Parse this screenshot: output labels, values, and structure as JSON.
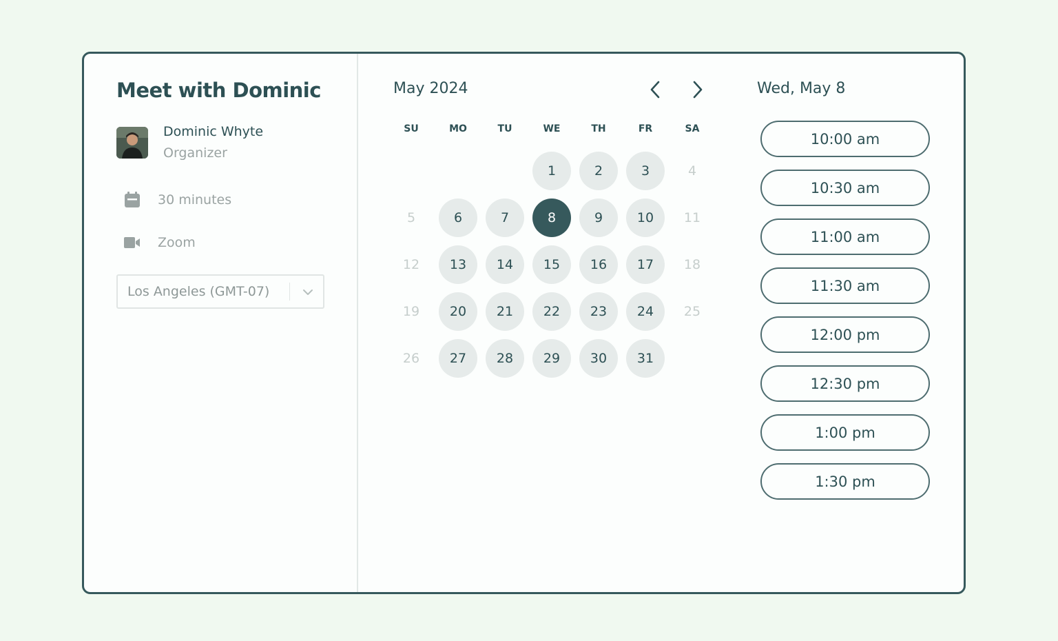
{
  "title": "Meet with Dominic",
  "organizer": {
    "name": "Dominic Whyte",
    "role": "Organizer"
  },
  "details": {
    "duration": "30 minutes",
    "duration_icon": "calendar-icon",
    "location": "Zoom",
    "location_icon": "video-camera-icon"
  },
  "timezone": {
    "value": "Los Angeles (GMT-07)"
  },
  "calendar": {
    "month_label": "May 2024",
    "weekdays": [
      "SU",
      "MO",
      "TU",
      "WE",
      "TH",
      "FR",
      "SA"
    ],
    "weeks": [
      [
        null,
        null,
        null,
        {
          "d": "1",
          "s": "available"
        },
        {
          "d": "2",
          "s": "available"
        },
        {
          "d": "3",
          "s": "available"
        },
        {
          "d": "4",
          "s": "disabled"
        }
      ],
      [
        {
          "d": "5",
          "s": "disabled"
        },
        {
          "d": "6",
          "s": "available"
        },
        {
          "d": "7",
          "s": "available"
        },
        {
          "d": "8",
          "s": "selected"
        },
        {
          "d": "9",
          "s": "available"
        },
        {
          "d": "10",
          "s": "available"
        },
        {
          "d": "11",
          "s": "disabled"
        }
      ],
      [
        {
          "d": "12",
          "s": "disabled"
        },
        {
          "d": "13",
          "s": "available"
        },
        {
          "d": "14",
          "s": "available"
        },
        {
          "d": "15",
          "s": "available"
        },
        {
          "d": "16",
          "s": "available"
        },
        {
          "d": "17",
          "s": "available"
        },
        {
          "d": "18",
          "s": "disabled"
        }
      ],
      [
        {
          "d": "19",
          "s": "disabled"
        },
        {
          "d": "20",
          "s": "available"
        },
        {
          "d": "21",
          "s": "available"
        },
        {
          "d": "22",
          "s": "available"
        },
        {
          "d": "23",
          "s": "available"
        },
        {
          "d": "24",
          "s": "available"
        },
        {
          "d": "25",
          "s": "disabled"
        }
      ],
      [
        {
          "d": "26",
          "s": "disabled"
        },
        {
          "d": "27",
          "s": "available"
        },
        {
          "d": "28",
          "s": "available"
        },
        {
          "d": "29",
          "s": "available"
        },
        {
          "d": "30",
          "s": "available"
        },
        {
          "d": "31",
          "s": "available"
        },
        null
      ]
    ]
  },
  "selected_date_label": "Wed, May 8",
  "time_slots": [
    "10:00 am",
    "10:30 am",
    "11:00 am",
    "11:30 am",
    "12:00 pm",
    "12:30 pm",
    "1:00 pm",
    "1:30 pm"
  ],
  "colors": {
    "background": "#f0f9f0",
    "primary": "#36595c",
    "available_day": "#e6ebea",
    "muted_text": "#9aa3a2"
  }
}
